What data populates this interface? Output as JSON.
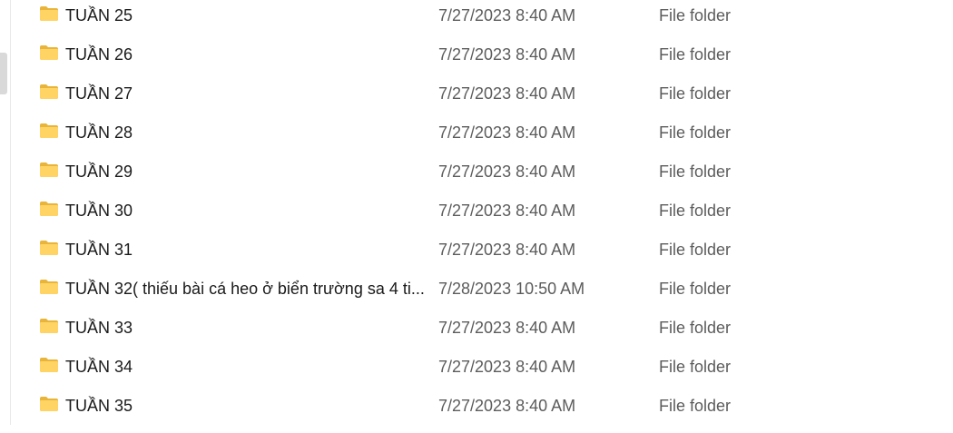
{
  "colors": {
    "folder_back": "#e8b53a",
    "folder_front": "#ffd464",
    "name_text": "#1a1a1a",
    "meta_text": "#5c5c5c"
  },
  "files": [
    {
      "name": "TUẦN 25",
      "date_modified": "7/27/2023 8:40 AM",
      "type": "File folder",
      "icon": "folder-icon"
    },
    {
      "name": "TUẦN 26",
      "date_modified": "7/27/2023 8:40 AM",
      "type": "File folder",
      "icon": "folder-icon"
    },
    {
      "name": "TUẦN 27",
      "date_modified": "7/27/2023 8:40 AM",
      "type": "File folder",
      "icon": "folder-icon"
    },
    {
      "name": "TUẦN 28",
      "date_modified": "7/27/2023 8:40 AM",
      "type": "File folder",
      "icon": "folder-icon"
    },
    {
      "name": "TUẦN 29",
      "date_modified": "7/27/2023 8:40 AM",
      "type": "File folder",
      "icon": "folder-icon"
    },
    {
      "name": "TUẦN 30",
      "date_modified": "7/27/2023 8:40 AM",
      "type": "File folder",
      "icon": "folder-icon"
    },
    {
      "name": "TUẦN 31",
      "date_modified": "7/27/2023 8:40 AM",
      "type": "File folder",
      "icon": "folder-icon"
    },
    {
      "name": "TUẦN 32( thiếu bài cá heo ở biển trường sa 4 ti...",
      "date_modified": "7/28/2023 10:50 AM",
      "type": "File folder",
      "icon": "folder-icon"
    },
    {
      "name": "TUẦN 33",
      "date_modified": "7/27/2023 8:40 AM",
      "type": "File folder",
      "icon": "folder-icon"
    },
    {
      "name": "TUẦN 34",
      "date_modified": "7/27/2023 8:40 AM",
      "type": "File folder",
      "icon": "folder-icon"
    },
    {
      "name": "TUẦN 35",
      "date_modified": "7/27/2023 8:40 AM",
      "type": "File folder",
      "icon": "folder-icon"
    }
  ]
}
